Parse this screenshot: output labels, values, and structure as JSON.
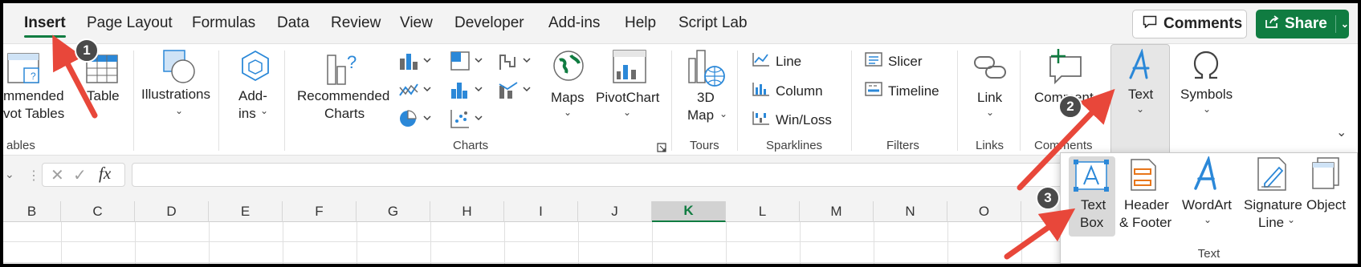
{
  "menu": {
    "tabs": [
      "Insert",
      "Page Layout",
      "Formulas",
      "Data",
      "Review",
      "View",
      "Developer",
      "Add-ins",
      "Help",
      "Script Lab"
    ],
    "comments_label": "Comments",
    "share_label": "Share"
  },
  "ribbon": {
    "recommended_pivot_label_1": "mmended",
    "recommended_pivot_label_2": "vot Tables",
    "table_label": "Table",
    "tables_group": "ables",
    "illustrations_label": "Illustrations",
    "addins_label_1": "Add-",
    "addins_label_2": "ins",
    "recommended_charts_1": "Recommended",
    "recommended_charts_2": "Charts",
    "maps_label": "Maps",
    "pivotchart_label": "PivotChart",
    "charts_group": "Charts",
    "map3d_label_1": "3D",
    "map3d_label_2": "Map",
    "tours_group": "Tours",
    "spark_line": "Line",
    "spark_column": "Column",
    "spark_winloss": "Win/Loss",
    "sparklines_group": "Sparklines",
    "slicer": "Slicer",
    "timeline": "Timeline",
    "filters_group": "Filters",
    "link_label": "Link",
    "links_group": "Links",
    "comment_label": "Comment",
    "comments_group": "Comments",
    "text_label": "Text",
    "symbols_label": "Symbols"
  },
  "formula_bar": {
    "fx": "fx"
  },
  "columns": [
    "B",
    "C",
    "D",
    "E",
    "F",
    "G",
    "H",
    "I",
    "J",
    "K",
    "L",
    "M",
    "N",
    "O"
  ],
  "selected_column": "K",
  "text_panel": {
    "textbox_1": "Text",
    "textbox_2": "Box",
    "header_1": "Header",
    "header_2": "& Footer",
    "wordart": "WordArt",
    "signature_1": "Signature",
    "signature_2": "Line",
    "object": "Object",
    "group_label": "Text"
  },
  "steps": [
    "1",
    "2",
    "3"
  ],
  "colors": {
    "accent_green": "#107c41",
    "excel_blue": "#2b88d8",
    "arrow_red": "#e8473a"
  }
}
